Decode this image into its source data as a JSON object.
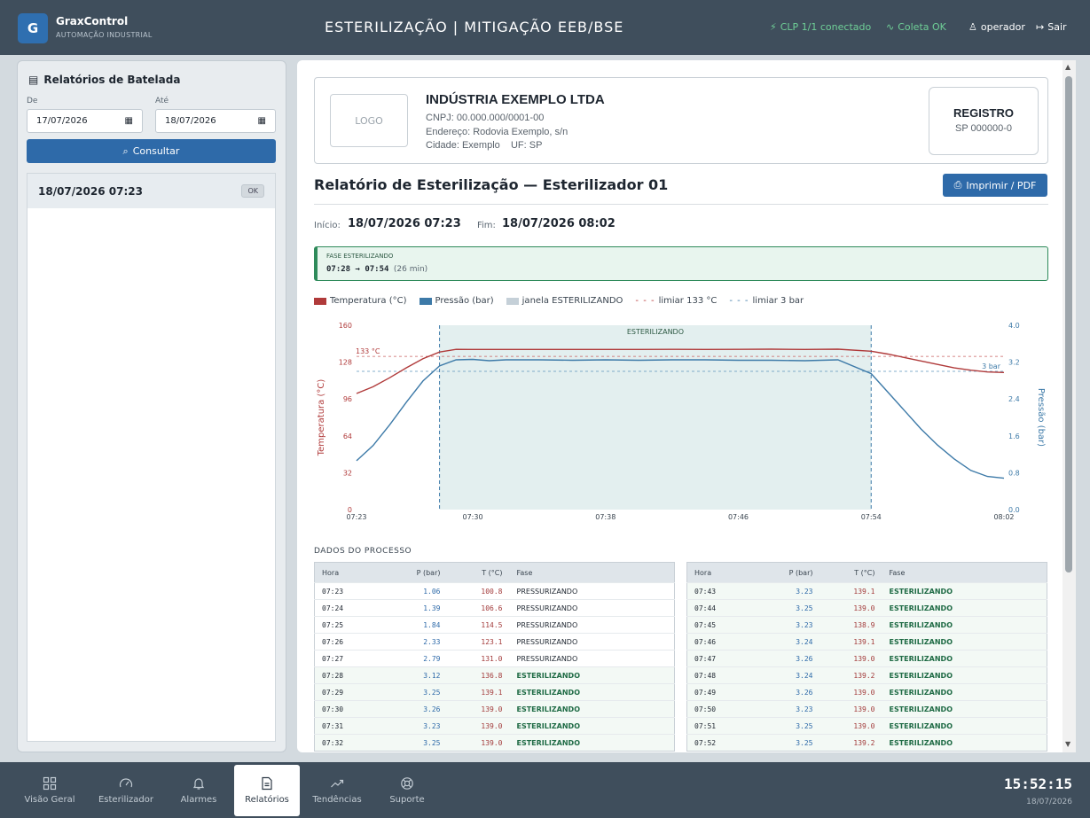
{
  "app": {
    "brand": "GraxControl",
    "brand_sub": "AUTOMAÇÃO INDUSTRIAL",
    "logo_letter": "G",
    "title": "ESTERILIZAÇÃO | MITIGAÇÃO EEB/BSE"
  },
  "status": {
    "clp": "CLP 1/1 conectado",
    "coleta": "Coleta OK",
    "user": "operador",
    "logout": "Sair"
  },
  "sidebar": {
    "title": "Relatórios de Batelada",
    "from_label": "De",
    "from_value": "17/07/2026",
    "to_label": "Até",
    "to_value": "18/07/2026",
    "consult_label": "Consultar",
    "batches": [
      {
        "label": "18/07/2026 07:23",
        "badge": "OK"
      }
    ]
  },
  "report": {
    "logo_placeholder": "LOGO",
    "company": "INDÚSTRIA EXEMPLO LTDA",
    "cnpj": "CNPJ: 00.000.000/0001-00",
    "address": "Endereço: Rodovia Exemplo, s/n",
    "city": "Cidade: Exemplo    UF: SP",
    "registry_title": "REGISTRO",
    "registry_value": "SP 000000-0",
    "title": "Relatório de Esterilização — Esterilizador 01",
    "print_label": "Imprimir / PDF",
    "start_label": "Início:",
    "start_value": "18/07/2026 07:23",
    "end_label": "Fim:",
    "end_value": "18/07/2026 08:02",
    "phase_title": "FASE ESTERILIZANDO",
    "phase_range": "07:28 → 07:54",
    "phase_duration": "(26 min)",
    "process_data_title": "DADOS DO PROCESSO",
    "table_headers": [
      "Hora",
      "P (bar)",
      "T (°C)",
      "Fase"
    ],
    "table_left": [
      [
        "07:23",
        "1.06",
        "100.8",
        "PRESSURIZANDO"
      ],
      [
        "07:24",
        "1.39",
        "106.6",
        "PRESSURIZANDO"
      ],
      [
        "07:25",
        "1.84",
        "114.5",
        "PRESSURIZANDO"
      ],
      [
        "07:26",
        "2.33",
        "123.1",
        "PRESSURIZANDO"
      ],
      [
        "07:27",
        "2.79",
        "131.0",
        "PRESSURIZANDO"
      ],
      [
        "07:28",
        "3.12",
        "136.8",
        "ESTERILIZANDO"
      ],
      [
        "07:29",
        "3.25",
        "139.1",
        "ESTERILIZANDO"
      ],
      [
        "07:30",
        "3.26",
        "139.0",
        "ESTERILIZANDO"
      ],
      [
        "07:31",
        "3.23",
        "139.0",
        "ESTERILIZANDO"
      ],
      [
        "07:32",
        "3.25",
        "139.0",
        "ESTERILIZANDO"
      ]
    ],
    "table_right": [
      [
        "07:43",
        "3.23",
        "139.1",
        "ESTERILIZANDO"
      ],
      [
        "07:44",
        "3.25",
        "139.0",
        "ESTERILIZANDO"
      ],
      [
        "07:45",
        "3.23",
        "138.9",
        "ESTERILIZANDO"
      ],
      [
        "07:46",
        "3.24",
        "139.1",
        "ESTERILIZANDO"
      ],
      [
        "07:47",
        "3.26",
        "139.0",
        "ESTERILIZANDO"
      ],
      [
        "07:48",
        "3.24",
        "139.2",
        "ESTERILIZANDO"
      ],
      [
        "07:49",
        "3.26",
        "139.0",
        "ESTERILIZANDO"
      ],
      [
        "07:50",
        "3.23",
        "139.0",
        "ESTERILIZANDO"
      ],
      [
        "07:51",
        "3.25",
        "139.0",
        "ESTERILIZANDO"
      ],
      [
        "07:52",
        "3.25",
        "139.2",
        "ESTERILIZANDO"
      ]
    ]
  },
  "chart_data": {
    "type": "line",
    "legend": [
      "Temperatura (°C)",
      "Pressão (bar)",
      "janela ESTERILIZANDO",
      "limiar 133 °C",
      "limiar 3 bar"
    ],
    "ylabel_left": "Temperatura (°C)",
    "ylabel_right": "Pressão (bar)",
    "y_left_ticks": [
      "160",
      "128",
      "96",
      "64",
      "32",
      "0"
    ],
    "y_right_ticks": [
      "4.0",
      "3.2",
      "2.4",
      "1.6",
      "0.8",
      "0.0"
    ],
    "x_ticks": [
      "07:23",
      "07:30",
      "07:38",
      "07:46",
      "07:54",
      "08:02"
    ],
    "ylim_left": [
      0,
      160
    ],
    "ylim_right": [
      0,
      4.0
    ],
    "window_label": "ESTERILIZANDO",
    "window_start": "07:28",
    "window_end": "07:54",
    "thresholds": {
      "temp": 133,
      "temp_label": "133 °C",
      "pressure": 3,
      "pressure_label": "3 bar"
    },
    "x": [
      "07:23",
      "07:24",
      "07:25",
      "07:26",
      "07:27",
      "07:28",
      "07:29",
      "07:30",
      "07:31",
      "07:32",
      "07:34",
      "07:36",
      "07:38",
      "07:40",
      "07:42",
      "07:44",
      "07:46",
      "07:48",
      "07:50",
      "07:52",
      "07:54",
      "07:55",
      "07:56",
      "07:57",
      "07:58",
      "07:59",
      "08:00",
      "08:01",
      "08:02"
    ],
    "series": [
      {
        "name": "Temperatura (°C)",
        "axis": "left",
        "color": "#b03a3a",
        "values": [
          100.8,
          106.6,
          114.5,
          123.1,
          131.0,
          136.8,
          139.1,
          139.0,
          139.0,
          139.0,
          139.0,
          139.0,
          139.0,
          139.0,
          139.1,
          139.0,
          139.1,
          139.2,
          139.0,
          139.2,
          137.5,
          135,
          132,
          129,
          126,
          123,
          121,
          119.5,
          119
        ]
      },
      {
        "name": "Pressão (bar)",
        "axis": "right",
        "color": "#3d7aa8",
        "values": [
          1.06,
          1.39,
          1.84,
          2.33,
          2.79,
          3.12,
          3.25,
          3.26,
          3.23,
          3.25,
          3.25,
          3.24,
          3.25,
          3.24,
          3.25,
          3.25,
          3.24,
          3.24,
          3.23,
          3.25,
          2.95,
          2.55,
          2.15,
          1.75,
          1.4,
          1.1,
          0.85,
          0.72,
          0.68
        ]
      }
    ]
  },
  "bottom_nav": [
    {
      "label": "Visão Geral",
      "icon": "grid-icon"
    },
    {
      "label": "Esterilizador",
      "icon": "gauge-icon"
    },
    {
      "label": "Alarmes",
      "icon": "bell-icon"
    },
    {
      "label": "Relatórios",
      "icon": "report-icon",
      "active": true
    },
    {
      "label": "Tendências",
      "icon": "trend-icon"
    },
    {
      "label": "Suporte",
      "icon": "lifebuoy-icon"
    }
  ],
  "clock": {
    "time": "15:52:15",
    "date": "18/07/2026"
  },
  "colors": {
    "topbar": "#3f4e5c",
    "accent": "#2e6aa9",
    "temp": "#b03a3a",
    "pressure": "#3d7aa8",
    "phase_green": "#2e8a5a"
  }
}
